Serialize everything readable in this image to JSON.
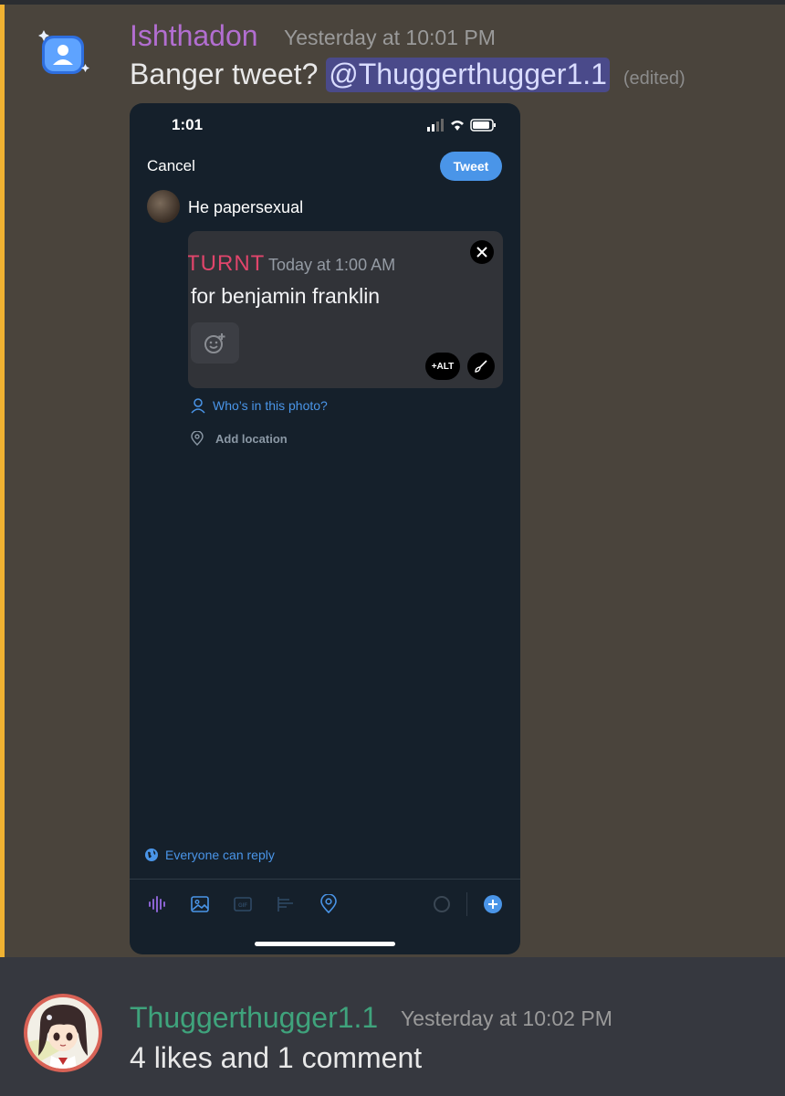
{
  "message1": {
    "author": "Ishthadon",
    "timestamp": "Yesterday at 10:01 PM",
    "text": "Banger tweet?",
    "mention": "@Thuggerthugger1.1",
    "edited_label": "(edited)",
    "colors": {
      "author": "#b26ed0",
      "mention_highlight": "#f0b232"
    }
  },
  "attachment": {
    "status_time": "1:01",
    "cancel_label": "Cancel",
    "tweet_label": "Tweet",
    "tweet_text": "He papersexual",
    "embedded": {
      "author": "TURNT",
      "timestamp": "Today at 1:00 AM",
      "text": "for benjamin franklin",
      "alt_label": "+ALT",
      "icons": [
        "add-reaction-icon",
        "close-icon",
        "brush-icon"
      ]
    },
    "tag_people_label": "Who’s in this photo?",
    "add_location_label": "Add location",
    "reply_setting_label": "Everyone can reply",
    "toolbar_icons": [
      "audio-wave-icon",
      "image-icon",
      "gif-icon",
      "poll-icon",
      "location-pin-icon",
      "progress-ring-icon",
      "add-thread-icon"
    ],
    "colors": {
      "background": "#15202b",
      "accent": "#4a95e8"
    }
  },
  "message2": {
    "author": "Thuggerthugger1.1",
    "timestamp": "Yesterday at 10:02 PM",
    "text": "4 likes and 1 comment",
    "colors": {
      "author": "#3fa37c"
    }
  }
}
